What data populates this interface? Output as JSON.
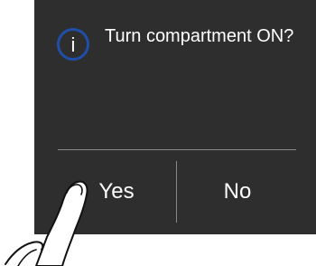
{
  "dialog": {
    "message": "Turn compartment ON?",
    "icon": "info-icon",
    "yes_label": "Yes",
    "no_label": "No"
  },
  "colors": {
    "panel_background": "#2e2e2e",
    "text": "#ffffff",
    "icon_ring": "#1f4fa8",
    "divider": "#8a8a8a"
  },
  "overlay": {
    "icon": "pointing-finger-icon"
  }
}
